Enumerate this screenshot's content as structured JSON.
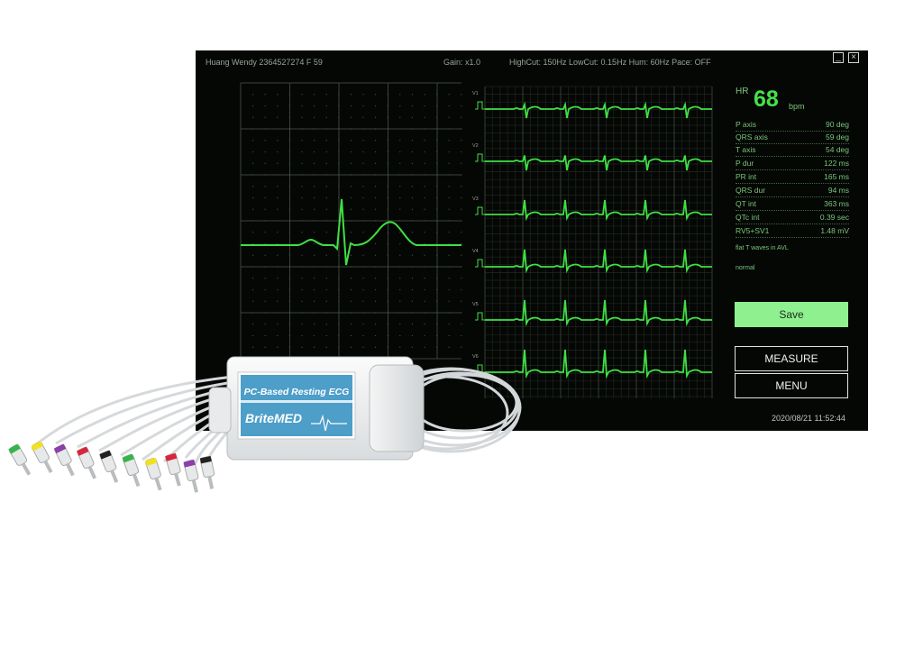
{
  "header": {
    "patient": "Huang Wendy  2364527274   F   59",
    "gain": "Gain: x1.0",
    "filters": "HighCut: 150Hz  LowCut: 0.15Hz  Hum: 60Hz  Pace: OFF",
    "minimize_icon": "minimize-icon",
    "close_icon": "close-icon"
  },
  "rhythm_leads": [
    "V1",
    "V2",
    "V3",
    "V4",
    "V5",
    "V6"
  ],
  "hr": {
    "label": "HR",
    "value": "68",
    "unit": "bpm"
  },
  "measurements": [
    {
      "name": "P axis",
      "value": "90 deg"
    },
    {
      "name": "QRS axis",
      "value": "59 deg"
    },
    {
      "name": "T axis",
      "value": "54 deg"
    },
    {
      "name": "P dur",
      "value": "122 ms"
    },
    {
      "name": "PR int",
      "value": "165 ms"
    },
    {
      "name": "QRS dur",
      "value": "94 ms"
    },
    {
      "name": "QT int",
      "value": "363 ms"
    },
    {
      "name": "QTc int",
      "value": "0.39 sec"
    },
    {
      "name": "RV5+SV1",
      "value": "1.48 mV"
    }
  ],
  "interpretation": [
    "flat T waves in AVL",
    "normal"
  ],
  "buttons": {
    "save": "Save",
    "measure": "MEASURE",
    "menu": "MENU"
  },
  "timestamp": "2020/08/21  11:52:44",
  "device": {
    "title": "PC-Based Resting ECG",
    "brand": "BriteMED"
  },
  "colors": {
    "screen_bg": "#050705",
    "trace": "#3fe043",
    "save_button": "#8ff08f",
    "device_label_blue": "#4d9ec9"
  }
}
